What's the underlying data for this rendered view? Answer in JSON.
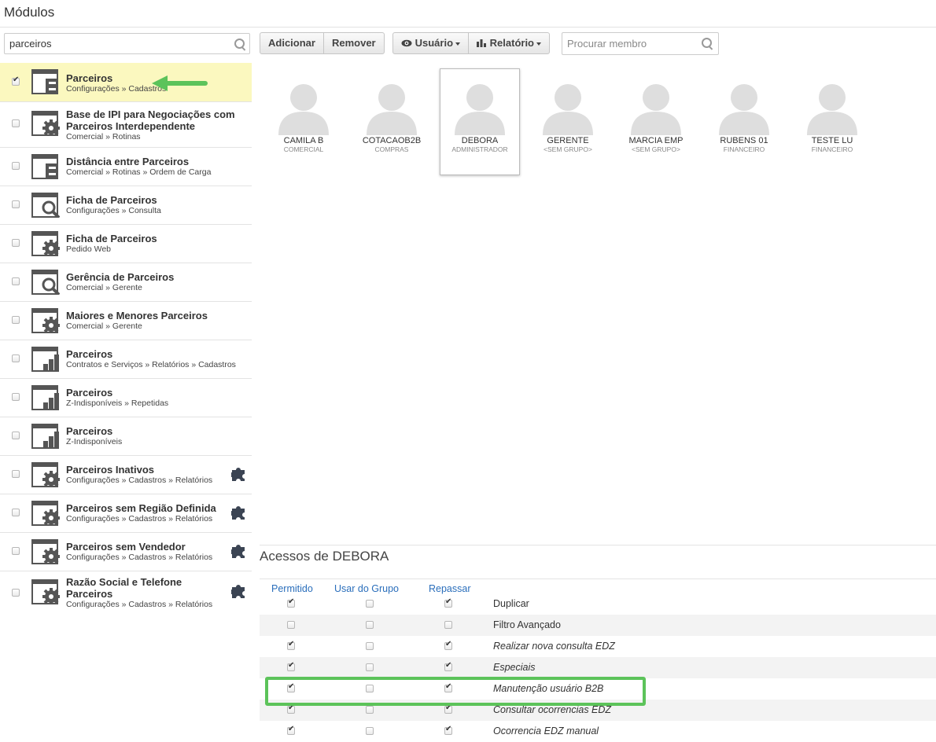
{
  "page": {
    "title": "Módulos"
  },
  "left_search": {
    "value": "parceiros",
    "icon": "search-icon"
  },
  "modules": [
    {
      "name": "Parceiros",
      "path": "Configurações » Cadastros",
      "checked": true,
      "selected": true,
      "icon": "form-icon"
    },
    {
      "name": "Base de IPI para Negociações com Parceiros Interdependente",
      "path": "Comercial » Rotinas",
      "icon": "gear-icon"
    },
    {
      "name": "Distância entre Parceiros",
      "path": "Comercial » Rotinas » Ordem de Carga",
      "icon": "form-icon"
    },
    {
      "name": "Ficha de Parceiros",
      "path": "Configurações » Consulta",
      "icon": "magnifier-icon"
    },
    {
      "name": "Ficha de Parceiros",
      "path": "Pedido Web",
      "icon": "gear-icon"
    },
    {
      "name": "Gerência de Parceiros",
      "path": "Comercial » Gerente",
      "icon": "magnifier-icon"
    },
    {
      "name": "Maiores e Menores Parceiros",
      "path": "Comercial » Gerente",
      "icon": "gear-icon"
    },
    {
      "name": "Parceiros",
      "path": "Contratos e Serviços » Relatórios » Cadastros",
      "icon": "bar-chart-icon"
    },
    {
      "name": "Parceiros",
      "path": "Z-Indisponíveis » Repetidas",
      "icon": "bar-chart-icon"
    },
    {
      "name": "Parceiros",
      "path": "Z-Indisponíveis",
      "icon": "bar-chart-icon"
    },
    {
      "name": "Parceiros Inativos",
      "path": "Configurações » Cadastros » Relatórios",
      "icon": "gear-icon",
      "extension": true
    },
    {
      "name": "Parceiros sem Região Definida",
      "path": "Configurações » Cadastros » Relatórios",
      "icon": "gear-icon",
      "extension": true
    },
    {
      "name": "Parceiros sem Vendedor",
      "path": "Configurações » Cadastros » Relatórios",
      "icon": "gear-icon",
      "extension": true
    },
    {
      "name": "Razão Social e Telefone Parceiros",
      "path": "Configurações » Cadastros » Relatórios",
      "icon": "gear-icon",
      "extension": true
    }
  ],
  "toolbar": {
    "add_label": "Adicionar",
    "remove_label": "Remover",
    "user_label": "Usuário",
    "report_label": "Relatório",
    "member_search_placeholder": "Procurar membro"
  },
  "members": [
    {
      "name": "CAMILA B",
      "group": "COMERCIAL"
    },
    {
      "name": "COTACAOB2B",
      "group": "COMPRAS"
    },
    {
      "name": "DEBORA",
      "group": "ADMINISTRADOR",
      "selected": true
    },
    {
      "name": "GERENTE",
      "group": "<SEM GRUPO>"
    },
    {
      "name": "MARCIA EMP",
      "group": "<SEM GRUPO>"
    },
    {
      "name": "RUBENS 01",
      "group": "FINANCEIRO"
    },
    {
      "name": "TESTE LU",
      "group": "FINANCEIRO"
    }
  ],
  "access": {
    "title": "Acessos de DEBORA",
    "headers": {
      "allowed": "Permitido",
      "group": "Usar do Grupo",
      "pass_on": "Repassar"
    },
    "rows": [
      {
        "label": "Duplicar",
        "allowed": true,
        "group": false,
        "pass_on": true,
        "italic": false
      },
      {
        "label": "Filtro Avançado",
        "allowed": false,
        "group": false,
        "pass_on": false,
        "italic": false
      },
      {
        "label": "Realizar nova consulta EDZ",
        "allowed": true,
        "group": false,
        "pass_on": true,
        "italic": true
      },
      {
        "label": "Especiais",
        "allowed": true,
        "group": false,
        "pass_on": true,
        "italic": true
      },
      {
        "label": "Manutenção usuário B2B",
        "allowed": true,
        "group": false,
        "pass_on": true,
        "italic": true
      },
      {
        "label": "Consultar ocorrencias EDZ",
        "allowed": true,
        "group": false,
        "pass_on": true,
        "italic": true
      },
      {
        "label": "Ocorrencia EDZ manual",
        "allowed": true,
        "group": false,
        "pass_on": true,
        "italic": true
      }
    ]
  },
  "colors": {
    "selected_row": "#fbf8bf",
    "annotation_green": "#5cc35a",
    "link_blue": "#2a6ebb"
  }
}
